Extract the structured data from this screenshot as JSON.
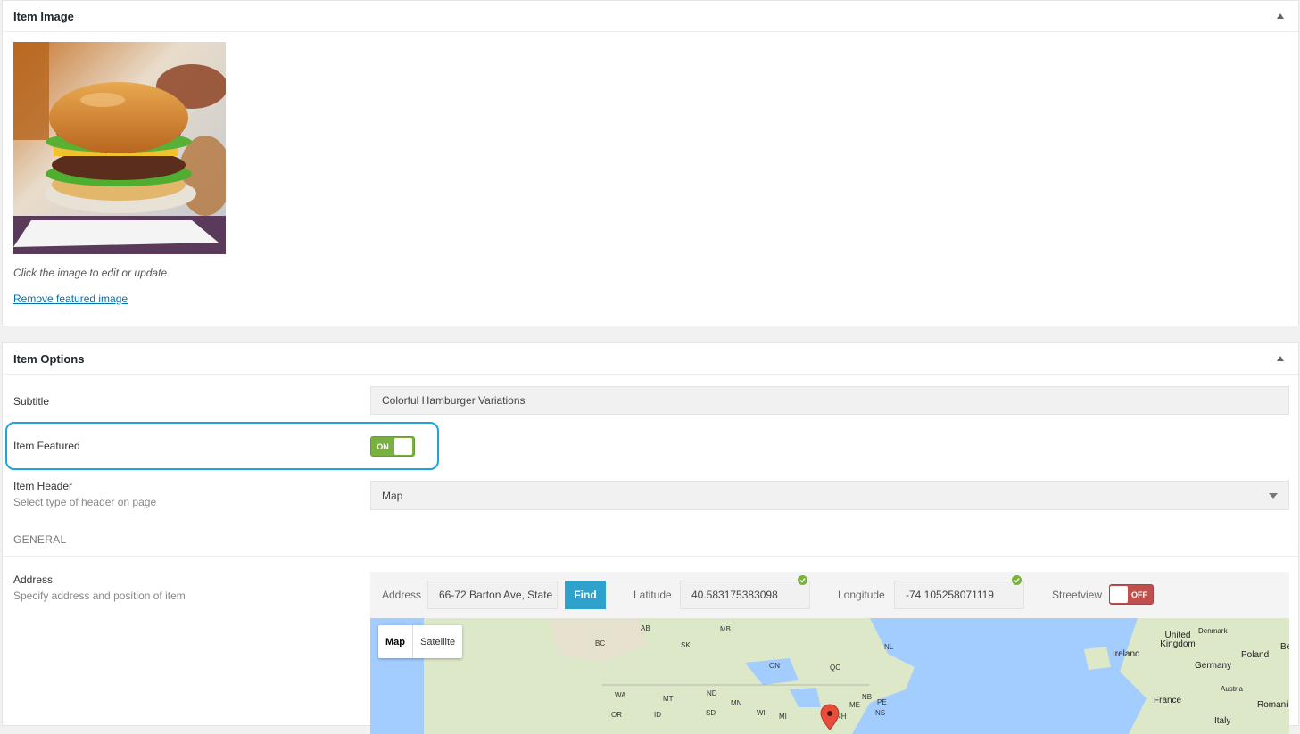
{
  "item_image": {
    "title": "Item Image",
    "hint": "Click the image to edit or update",
    "remove_link": "Remove featured image"
  },
  "item_options": {
    "title": "Item Options",
    "subtitle": {
      "label": "Subtitle",
      "value": "Colorful Hamburger Variations"
    },
    "featured": {
      "label": "Item Featured",
      "state": "ON"
    },
    "header": {
      "label": "Item Header",
      "description": "Select type of header on page",
      "value": "Map"
    },
    "section_general": "GENERAL",
    "address": {
      "label": "Address",
      "description": "Specify address and position of item",
      "address_label": "Address",
      "address_value": "66-72 Barton Ave, State",
      "find_label": "Find",
      "latitude_label": "Latitude",
      "latitude_value": "40.583175383098",
      "longitude_label": "Longitude",
      "longitude_value": "-74.105258071119",
      "streetview_label": "Streetview",
      "streetview_state": "OFF"
    },
    "map": {
      "map_tab": "Map",
      "satellite_tab": "Satellite",
      "labels": [
        "AB",
        "MB",
        "BC",
        "SK",
        "ON",
        "QC",
        "NL",
        "WA",
        "MT",
        "ND",
        "MN",
        "OR",
        "ID",
        "SD",
        "WI",
        "MI",
        "NB",
        "PE",
        "ME",
        "NS",
        "NH"
      ],
      "countries": [
        "United Kingdom",
        "Denmark",
        "Ireland",
        "Germany",
        "Poland",
        "France",
        "Austria",
        "Romani",
        "Italy",
        "Be"
      ]
    }
  },
  "colors": {
    "accent": "#2ea2cc",
    "on": "#7ab03f",
    "off": "#c0504d",
    "highlight": "#1ea3df"
  }
}
